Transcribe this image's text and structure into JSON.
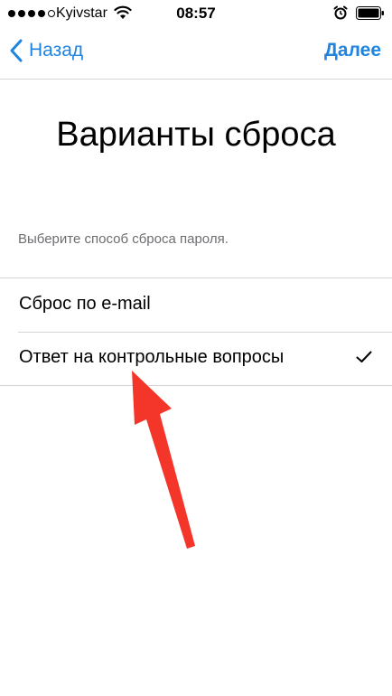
{
  "status_bar": {
    "carrier": "Kyivstar",
    "time": "08:57",
    "signal_bars_filled": 4,
    "signal_bars_total": 5,
    "icons": [
      "signal-icon",
      "wifi-icon",
      "alarm-icon",
      "battery-icon"
    ]
  },
  "nav": {
    "back_label": "Назад",
    "next_label": "Далее",
    "accent_color": "#1f83e0"
  },
  "title": "Варианты сброса",
  "caption": "Выберите способ сброса пароля.",
  "options": [
    {
      "label": "Сброс по e-mail",
      "selected": false
    },
    {
      "label": "Ответ на контрольные вопросы",
      "selected": true
    }
  ],
  "annotation": {
    "color": "#f4352a",
    "icon": "red-arrow-icon"
  }
}
